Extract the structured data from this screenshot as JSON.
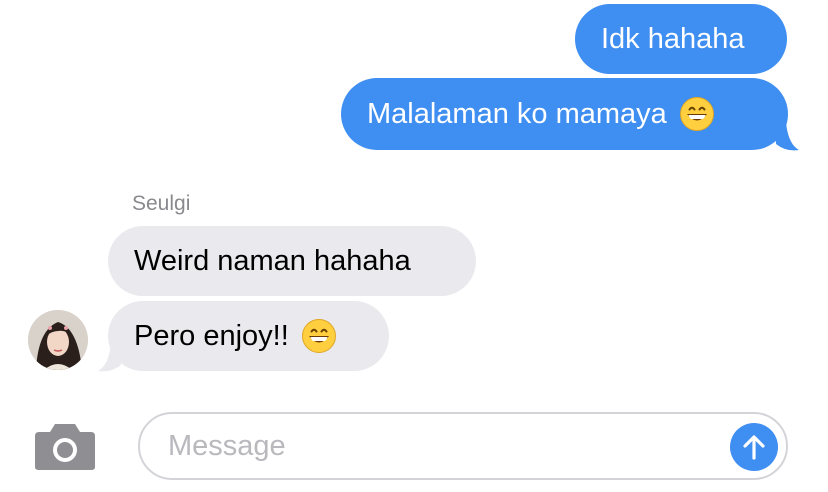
{
  "thread": {
    "messages": [
      {
        "direction": "outgoing",
        "text": "Idk hahaha",
        "emoji": ""
      },
      {
        "direction": "outgoing",
        "text": "Malalaman ko mamaya",
        "emoji": "grinning-face"
      },
      {
        "direction": "incoming",
        "text": "Weird naman hahaha",
        "emoji": ""
      },
      {
        "direction": "incoming",
        "text": "Pero enjoy!!",
        "emoji": "grinning-face"
      }
    ],
    "incoming_sender": "Seulgi"
  },
  "composer": {
    "placeholder": "Message",
    "camera_icon": "camera-icon",
    "send_icon": "arrow-up-icon"
  },
  "colors": {
    "outgoing_bubble": "#3f8ef1",
    "incoming_bubble": "#e9e9ee",
    "sender_label": "#8a8a8e",
    "placeholder": "#b8b8bd",
    "camera_icon": "#8e8e93"
  }
}
